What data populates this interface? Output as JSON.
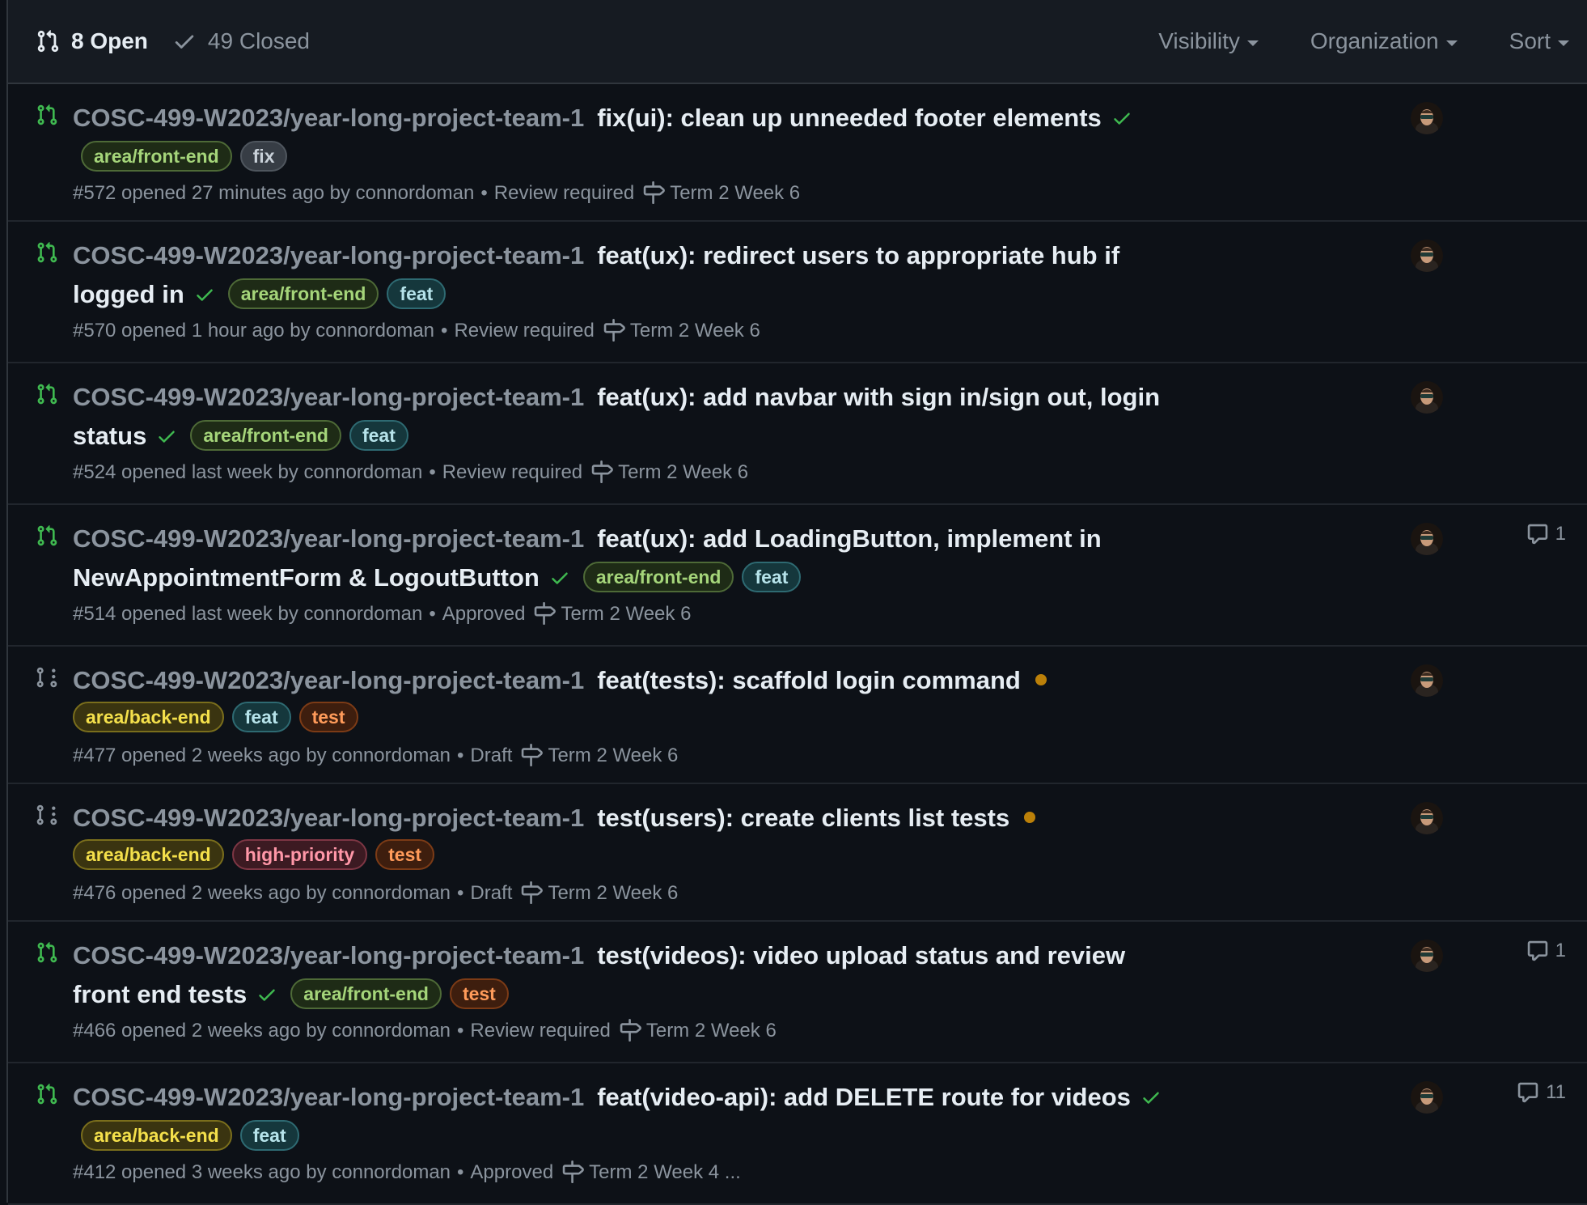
{
  "header": {
    "open_label": "8 Open",
    "closed_label": "49 Closed",
    "filters": [
      "Visibility",
      "Organization",
      "Sort"
    ]
  },
  "prs": [
    {
      "repo": "COSC-499-W2023/year-long-project-team-1",
      "title": "fix(ui): clean up unneeded footer elements",
      "status": "open",
      "check": true,
      "labels": [
        "area/front-end",
        "fix"
      ],
      "meta": "#572 opened 27 minutes ago by connordoman",
      "review": "Review required",
      "milestone": "Term 2 Week 6",
      "comments": ""
    },
    {
      "repo": "COSC-499-W2023/year-long-project-team-1",
      "title": "feat(ux): redirect users to appropriate hub if logged in",
      "status": "open",
      "check": true,
      "labels": [
        "area/front-end",
        "feat"
      ],
      "meta": "#570 opened 1 hour ago by connordoman",
      "review": "Review required",
      "milestone": "Term 2 Week 6",
      "comments": ""
    },
    {
      "repo": "COSC-499-W2023/year-long-project-team-1",
      "title": "feat(ux): add navbar with sign in/sign out, login status",
      "status": "open",
      "check": true,
      "labels": [
        "area/front-end",
        "feat"
      ],
      "meta": "#524 opened last week by connordoman",
      "review": "Review required",
      "milestone": "Term 2 Week 6",
      "comments": ""
    },
    {
      "repo": "COSC-499-W2023/year-long-project-team-1",
      "title": "feat(ux): add LoadingButton, implement in NewAppointmentForm & LogoutButton",
      "status": "open",
      "check": true,
      "labels": [
        "area/front-end",
        "feat"
      ],
      "meta": "#514 opened last week by connordoman",
      "review": "Approved",
      "milestone": "Term 2 Week 6",
      "comments": "1"
    },
    {
      "repo": "COSC-499-W2023/year-long-project-team-1",
      "title": "feat(tests): scaffold login command",
      "status": "draft",
      "check": false,
      "labels": [
        "area/back-end",
        "feat",
        "test"
      ],
      "meta": "#477 opened 2 weeks ago by connordoman",
      "review": "Draft",
      "milestone": "Term 2 Week 6",
      "comments": ""
    },
    {
      "repo": "COSC-499-W2023/year-long-project-team-1",
      "title": "test(users): create clients list tests",
      "status": "draft",
      "check": false,
      "labels": [
        "area/back-end",
        "high-priority",
        "test"
      ],
      "meta": "#476 opened 2 weeks ago by connordoman",
      "review": "Draft",
      "milestone": "Term 2 Week 6",
      "comments": ""
    },
    {
      "repo": "COSC-499-W2023/year-long-project-team-1",
      "title": "test(videos): video upload status and review front end tests",
      "status": "open",
      "check": true,
      "labels": [
        "area/front-end",
        "test"
      ],
      "meta": "#466 opened 2 weeks ago by connordoman",
      "review": "Review required",
      "milestone": "Term 2 Week 6",
      "comments": "1"
    },
    {
      "repo": "COSC-499-W2023/year-long-project-team-1",
      "title": "feat(video-api): add DELETE route for videos",
      "status": "open",
      "check": true,
      "labels": [
        "area/back-end",
        "feat"
      ],
      "meta": "#412 opened 3 weeks ago by connordoman",
      "review": "Approved",
      "milestone": "Term 2 Week 4 ...",
      "comments": "11"
    }
  ],
  "colors": {
    "open": "#3fb950",
    "draft": "#8b949e",
    "pending": "#bb8009"
  }
}
